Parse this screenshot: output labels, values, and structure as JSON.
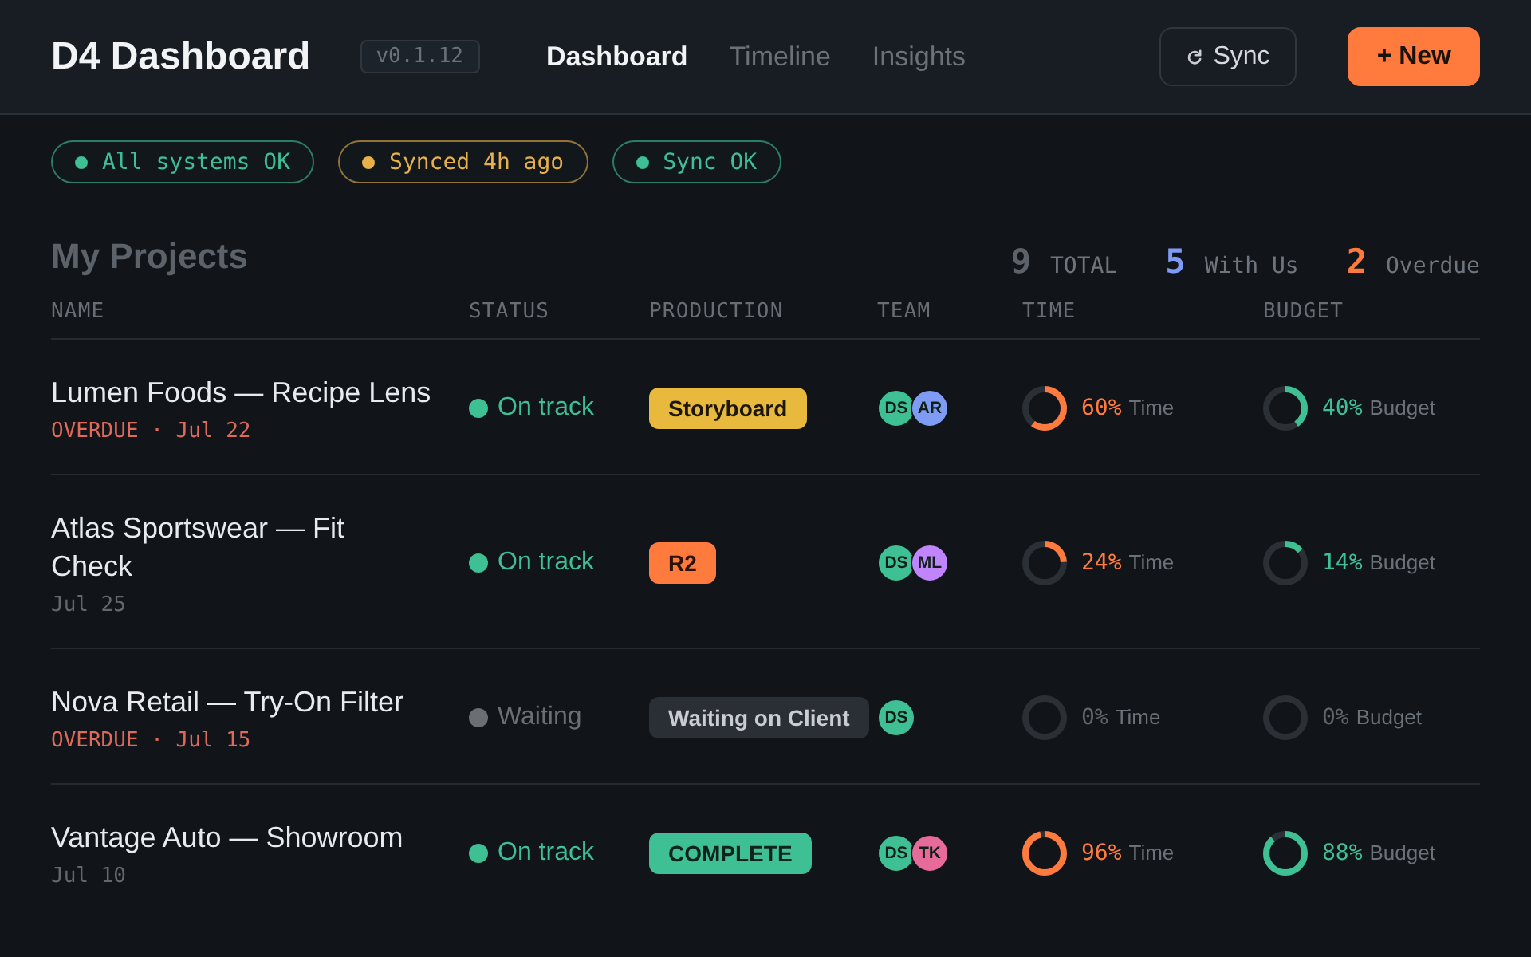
{
  "header": {
    "title": "D4 Dashboard",
    "version": "v0.1.12",
    "tabs": [
      {
        "label": "Dashboard",
        "selected": true
      },
      {
        "label": "Timeline",
        "selected": false
      },
      {
        "label": "Insights",
        "selected": false
      }
    ],
    "buttons": [
      {
        "kind": "secondary",
        "label": "Sync"
      },
      {
        "kind": "primary",
        "label": "+ New"
      }
    ]
  },
  "status_pills": [
    {
      "label": "All systems OK",
      "color": "#3fbf94"
    },
    {
      "label": "Synced 4h ago",
      "color": "#e8b04a"
    },
    {
      "label": "Sync OK",
      "color": "#3fbf94"
    }
  ],
  "projects": {
    "title": "My Projects",
    "stats": [
      {
        "value": "9",
        "label": "TOTAL",
        "color": "#5c6269"
      },
      {
        "value": "5",
        "label": "With Us",
        "color": "#7f9cf5"
      },
      {
        "value": "2",
        "label": "Overdue",
        "color": "#ff7a3d"
      }
    ],
    "columns": [
      "NAME",
      "STATUS",
      "PRODUCTION",
      "TEAM",
      "TIME",
      "BUDGET"
    ],
    "rows": [
      {
        "name": "Lumen Foods — Recipe Lens",
        "due": {
          "label": "OVERDUE · Jul 22",
          "overdue": true
        },
        "status": {
          "kind": "on_track",
          "label": "On track"
        },
        "production": {
          "kind": "storyboard",
          "label": "Storyboard"
        },
        "team": [
          {
            "initials": "DS",
            "color": "#3fbf94"
          },
          {
            "initials": "AR",
            "color": "#7f9cf5"
          }
        ],
        "time": {
          "level": 0.6,
          "percent": "60%",
          "label": "Time"
        },
        "budget": {
          "level": 0.4,
          "percent": "40%",
          "label": "Budget"
        }
      },
      {
        "name": "Atlas Sportswear — Fit Check",
        "due": {
          "label": "Jul 25",
          "overdue": false
        },
        "status": {
          "kind": "on_track",
          "label": "On track"
        },
        "production": {
          "kind": "revision",
          "label": "R2"
        },
        "team": [
          {
            "initials": "DS",
            "color": "#3fbf94"
          },
          {
            "initials": "ML",
            "color": "#c084fc"
          }
        ],
        "time": {
          "level": 0.24,
          "percent": "24%",
          "label": "Time"
        },
        "budget": {
          "level": 0.14,
          "percent": "14%",
          "label": "Budget"
        }
      },
      {
        "name": "Nova Retail — Try-On Filter",
        "due": {
          "label": "OVERDUE · Jul 15",
          "overdue": true
        },
        "status": {
          "kind": "waiting",
          "label": "Waiting"
        },
        "production": {
          "kind": "waiting",
          "label": "Waiting on Client"
        },
        "team": [
          {
            "initials": "DS",
            "color": "#3fbf94"
          }
        ],
        "time": {
          "level": 0,
          "percent": "0%",
          "label": "Time"
        },
        "budget": {
          "level": 0,
          "percent": "0%",
          "label": "Budget"
        }
      },
      {
        "name": "Vantage Auto — Showroom",
        "due": {
          "label": "Jul 10",
          "overdue": false
        },
        "status": {
          "kind": "on_track",
          "label": "On track"
        },
        "production": {
          "kind": "complete",
          "label": "COMPLETE"
        },
        "team": [
          {
            "initials": "DS",
            "color": "#3fbf94"
          },
          {
            "initials": "TK",
            "color": "#e66b9a"
          }
        ],
        "time": {
          "level": 0.96,
          "percent": "96%",
          "label": "Time"
        },
        "budget": {
          "level": 0.88,
          "percent": "88%",
          "label": "Budget"
        }
      }
    ]
  }
}
